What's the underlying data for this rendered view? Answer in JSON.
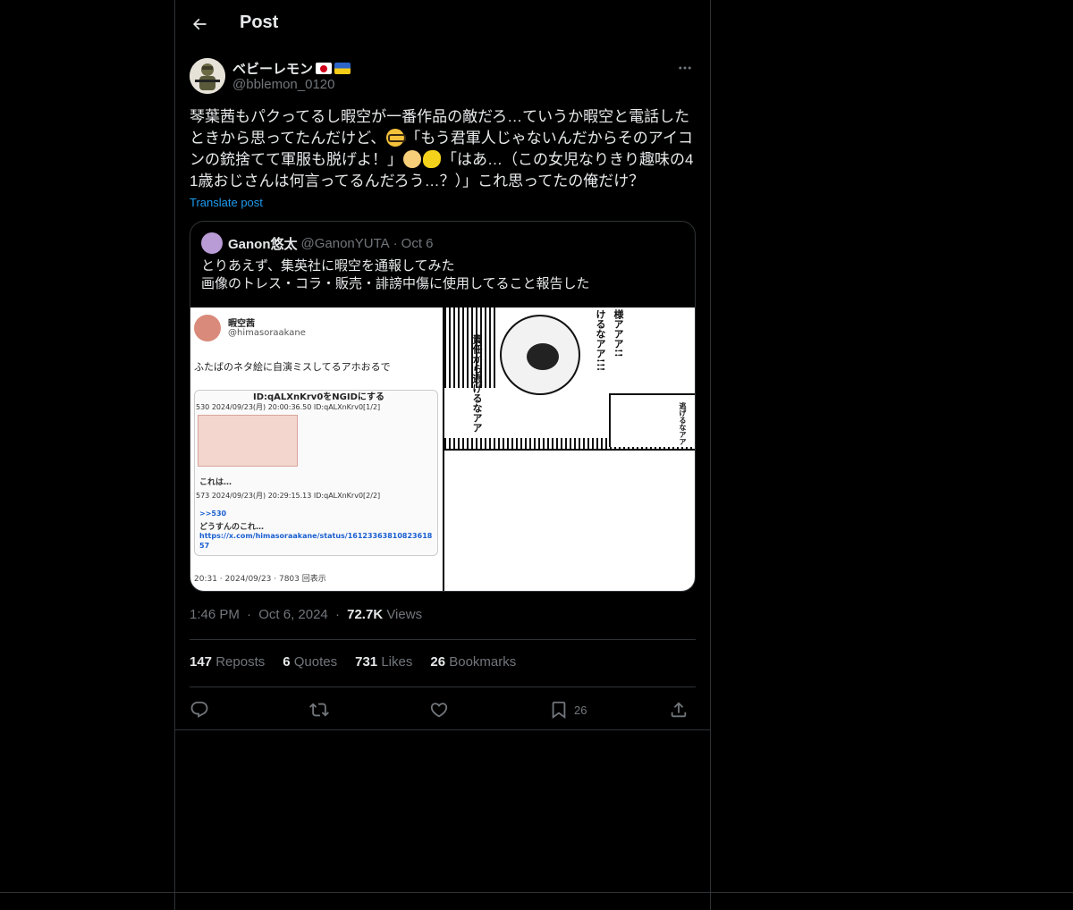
{
  "header": {
    "title": "Post"
  },
  "author": {
    "name": "ベビーレモン",
    "handle": "@bblemon_0120"
  },
  "post": {
    "text_1": "琴葉茜もパクってるし暇空が一番作品の敵だろ…ていうか暇空と電話したときから思ってたんだけど、",
    "text_2": "「もう君軍人じゃないんだからそのアイコンの銃捨てて軍服も脱げよ！」",
    "text_3": "「はあ…（この女児なりきり趣味の41歳おじさんは何言ってるんだろう…？）」これ思ってたの俺だけ？",
    "translate_label": "Translate post"
  },
  "quote": {
    "name": "Ganon悠太",
    "handle": "@GanonYUTA",
    "separator": "·",
    "date": "Oct 6",
    "text": "とりあえず、集英社に暇空を通報してみた\n画像のトレス・コラ・販売・誹謗中傷に使用してること報告した",
    "media": {
      "ss_name": "暇空茜",
      "ss_handle": "@himasoraakane",
      "ss_text": "ふたばのネタ絵に自演ミスしてるアホおるで",
      "ss_box_title": "ID:qALXnKrv0をNGIDにする",
      "ss_post1": "530 2024/09/23(月) 20:00:36.50 ID:qALXnKrv0[1/2]",
      "ss_post1_body": "これは…",
      "ss_post2": "573 2024/09/23(月) 20:29:15.13 ID:qALXnKrv0[2/2]",
      "ss_reply": ">>530",
      "ss_post2_body": "どうすんのこれ…",
      "ss_link": "https://x.com/himasoraakane/status/1612336381082361857",
      "ss_footer": "20:31 · 2024/09/23 · 7803 回表示",
      "manga_text_1": "様アアア!!",
      "manga_text_2": "けるなアア!!!",
      "manga_text_3": "責任から逃げるなアア",
      "manga_text_4": "逃げるなアア"
    }
  },
  "meta": {
    "time": "1:46 PM",
    "dot": "·",
    "date": "Oct 6, 2024",
    "views_count": "72.7K",
    "views_label": "Views"
  },
  "stats": {
    "reposts_count": "147",
    "reposts_label": "Reposts",
    "quotes_count": "6",
    "quotes_label": "Quotes",
    "likes_count": "731",
    "likes_label": "Likes",
    "bookmarks_count": "26",
    "bookmarks_label": "Bookmarks"
  },
  "actions": {
    "bookmark_count": "26"
  },
  "colors": {
    "background": "#000000",
    "text": "#e7e9ea",
    "secondary": "#71767b",
    "accent": "#1d9bf0",
    "border": "#2f3336"
  },
  "icons": [
    "back-arrow-icon",
    "more-icon",
    "reply-icon",
    "repost-icon",
    "like-icon",
    "bookmark-icon",
    "share-icon"
  ]
}
